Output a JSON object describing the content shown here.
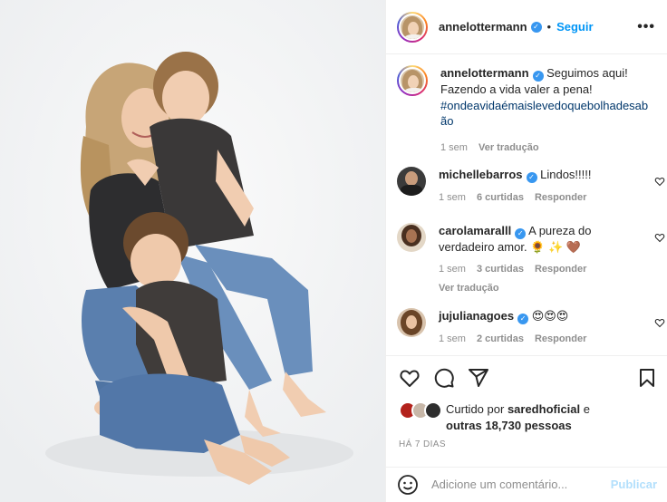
{
  "header": {
    "username": "annelottermann",
    "separator": "•",
    "follow_label": "Seguir",
    "more_icon": "more-horizontal-icon",
    "more_label": "•••"
  },
  "caption": {
    "username": "annelottermann",
    "text": "Seguimos aqui! Fazendo a vida valer a pena!",
    "hashtag": "#ondeavidaémaislevedoquebolhadesabão",
    "time": "1 sem",
    "translate": "Ver tradução"
  },
  "comments": [
    {
      "username": "michellebarros",
      "text": "Lindos!!!!!",
      "time": "1 sem",
      "likes": "6 curtidas",
      "reply": "Responder",
      "translate": ""
    },
    {
      "username": "carolamaralll",
      "text": "A pureza do verdadeiro amor. 🌻 ✨ 🤎",
      "time": "1 sem",
      "likes": "3 curtidas",
      "reply": "Responder",
      "translate": "Ver tradução"
    },
    {
      "username": "jujulianagoes",
      "text": "😍😍😍",
      "time": "1 sem",
      "likes": "2 curtidas",
      "reply": "Responder",
      "translate": ""
    }
  ],
  "likes": {
    "prefix": "Curtido por",
    "user": "saredhoficial",
    "conjunction": "e",
    "others": "outras 18,730 pessoas"
  },
  "time_ago": "HÁ 7 DIAS",
  "composer": {
    "placeholder": "Adicione um comentário...",
    "publish_label": "Publicar"
  },
  "colors": {
    "accent": "#0095f6",
    "verified": "#3897f0",
    "muted": "#8e8e8e",
    "publish_disabled": "#b2dffc"
  }
}
